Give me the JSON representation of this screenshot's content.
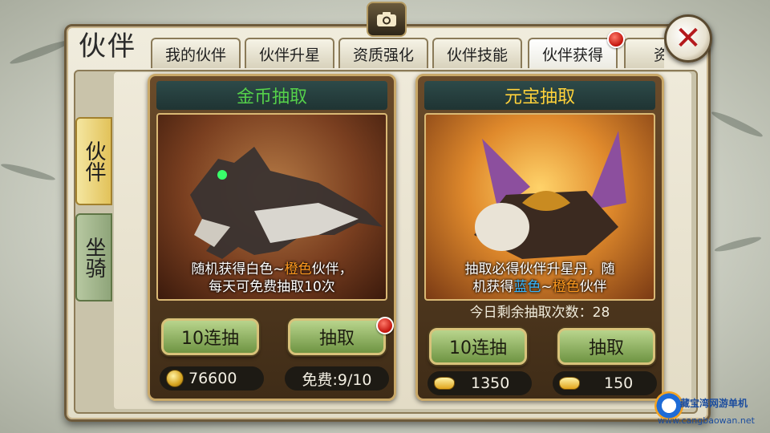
{
  "window": {
    "title": "伙伴"
  },
  "tabs": [
    {
      "label": "我的伙伴",
      "active": false
    },
    {
      "label": "伙伴升星",
      "active": false
    },
    {
      "label": "资质强化",
      "active": false
    },
    {
      "label": "伙伴技能",
      "active": false
    },
    {
      "label": "伙伴获得",
      "active": true,
      "badge": true
    },
    {
      "label": "资质",
      "active": false
    }
  ],
  "side_tabs": [
    {
      "label": "伙伴",
      "active": true
    },
    {
      "label": "坐骑",
      "active": false
    }
  ],
  "cards": {
    "gold": {
      "title": "金币抽取",
      "title_color": "#55d04a",
      "desc_line1_prefix": "随机获得白色~",
      "desc_line1_highlight": "橙色",
      "desc_line1_suffix": "伙伴，",
      "desc_line2": "每天可免费抽取10次",
      "btn_ten": "10连抽",
      "btn_draw": "抽取",
      "draw_badge": true,
      "cost_value": "76600",
      "free_text": "免费:9/10"
    },
    "ingot": {
      "title": "元宝抽取",
      "title_color": "#ffd23a",
      "desc_line1": "抽取必得伙伴升星丹，随",
      "desc_line2_prefix": "机获得",
      "desc_line2_blue": "蓝色",
      "desc_line2_sep": "~",
      "desc_line2_orange": "橙色",
      "desc_line2_suffix": "伙伴",
      "remaining": "今日剩余抽取次数：28",
      "btn_ten": "10连抽",
      "btn_draw": "抽取",
      "cost_ten": "1350",
      "cost_single": "150"
    }
  },
  "watermark": {
    "name": "藏宝湾网游单机",
    "url": "www.cangbaowan.net"
  },
  "icons": {
    "camera": "camera-icon",
    "close": "close-icon",
    "coin": "gold-coin-icon",
    "ingot": "ingot-icon"
  },
  "colors": {
    "highlight_orange": "#ff9a1f",
    "highlight_blue": "#37b6ff"
  }
}
